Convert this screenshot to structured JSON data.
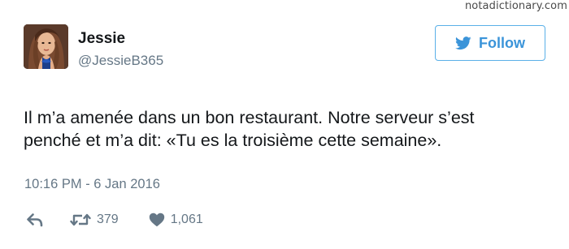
{
  "watermark": "notadictionary.com",
  "user": {
    "display_name": "Jessie",
    "handle": "@JessieB365"
  },
  "follow_button": {
    "label": "Follow"
  },
  "tweet": {
    "text_line_1": "Il m’a amenée dans un bon restaurant. Notre serveur s’est",
    "text_line_2": "penché et m’a dit: «Tu es la troisième cette semaine».",
    "timestamp": "10:16 PM - 6 Jan 2016"
  },
  "actions": {
    "retweet_count": "379",
    "like_count": "1,061"
  },
  "icons": {
    "avatar": "avatar-photo",
    "follow": "twitter-bird-icon",
    "reply": "reply-icon",
    "retweet": "retweet-icon",
    "like": "heart-icon"
  },
  "colors": {
    "accent": "#3b94d9",
    "button_border": "#5ab0e8",
    "secondary_text": "#657786",
    "primary_text": "#14171a",
    "background": "#ffffff"
  }
}
